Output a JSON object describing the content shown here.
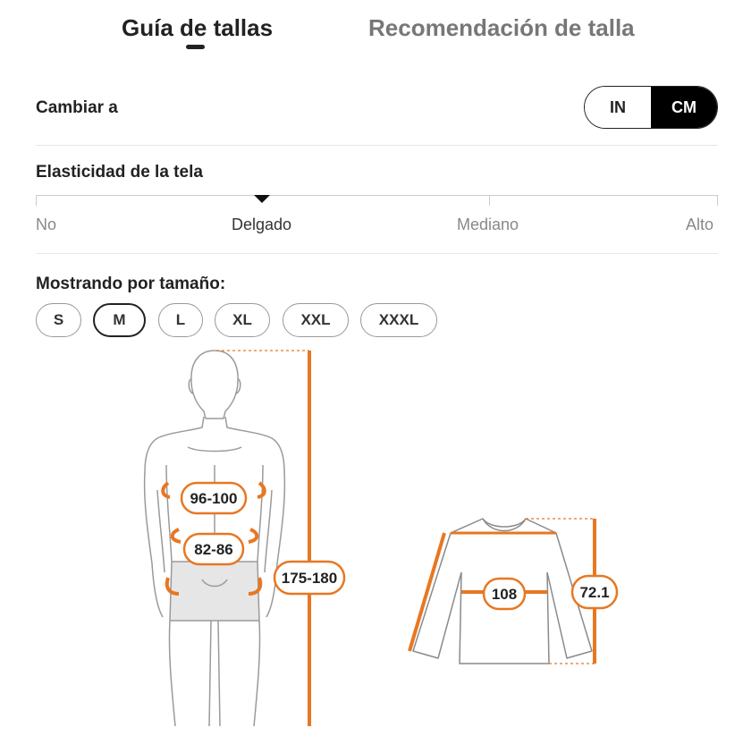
{
  "tabs": {
    "size_guide": "Guía de tallas",
    "size_recommendation": "Recomendación de talla"
  },
  "units": {
    "label": "Cambiar a",
    "options": [
      "IN",
      "CM"
    ],
    "selected": "CM"
  },
  "stretch": {
    "title": "Elasticidad de la tela",
    "levels": [
      "No",
      "Delgado",
      "Mediano",
      "Alto"
    ],
    "selected": "Delgado"
  },
  "sizes": {
    "title": "Mostrando por tamaño:",
    "options": [
      "S",
      "M",
      "L",
      "XL",
      "XXL",
      "XXXL"
    ],
    "selected": "M"
  },
  "body_measurements": {
    "chest": "96-100",
    "waist": "82-86",
    "height": "175-180"
  },
  "garment_measurements": {
    "chest_width": "108",
    "length": "72.1"
  },
  "colors": {
    "accent": "#E87722",
    "text": "#222222",
    "muted": "#888888"
  }
}
